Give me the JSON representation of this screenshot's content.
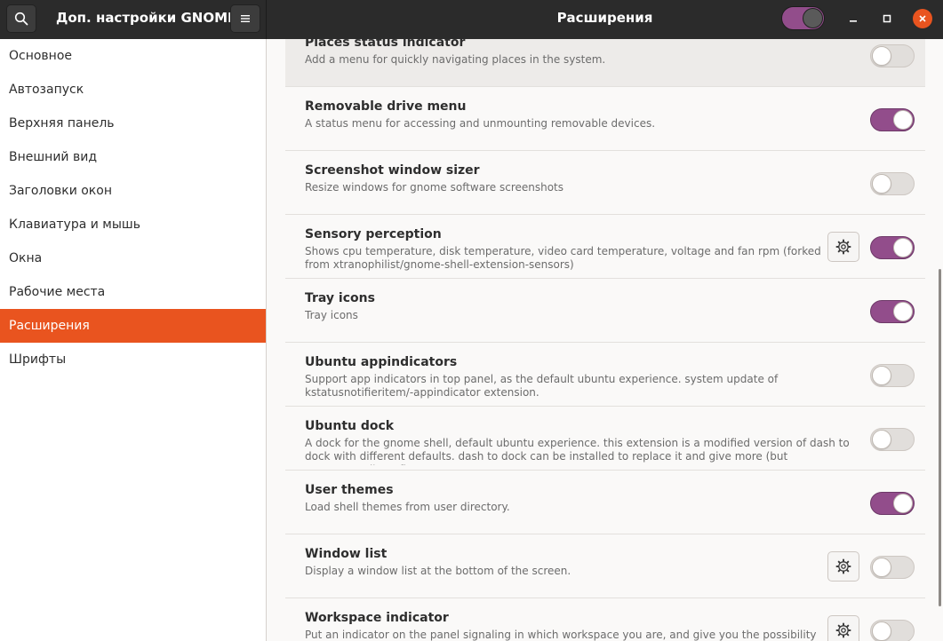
{
  "window": {
    "app_title": "Доп. настройки GNOME",
    "page_title": "Расширения",
    "global_toggle_on": true
  },
  "icons": {
    "search": "search-icon",
    "menu": "hamburger-menu-icon",
    "minimize": "minimize-icon",
    "maximize": "maximize-icon",
    "close": "close-icon",
    "settings": "gear-icon"
  },
  "colors": {
    "accent": "#e9541f",
    "switch_on": "#924d8b",
    "header": "#2b2b2b"
  },
  "sidebar": {
    "items": [
      {
        "label": "Основное"
      },
      {
        "label": "Автозапуск"
      },
      {
        "label": "Верхняя панель"
      },
      {
        "label": "Внешний вид"
      },
      {
        "label": "Заголовки окон"
      },
      {
        "label": "Клавиатура и мышь"
      },
      {
        "label": "Окна"
      },
      {
        "label": "Рабочие места"
      },
      {
        "label": "Расширения"
      },
      {
        "label": "Шрифты"
      }
    ],
    "active_label": "Расширения"
  },
  "extensions": [
    {
      "name": "Places status indicator",
      "description": "Add a menu for quickly navigating places in the system.",
      "enabled": false,
      "has_settings": false
    },
    {
      "name": "Removable drive menu",
      "description": "A status menu for accessing and unmounting removable devices.",
      "enabled": true,
      "has_settings": false
    },
    {
      "name": "Screenshot window sizer",
      "description": "Resize windows for gnome software screenshots",
      "enabled": false,
      "has_settings": false
    },
    {
      "name": "Sensory perception",
      "description": "Shows cpu temperature, disk temperature, video card temperature, voltage and fan rpm (forked from xtranophilist/gnome-shell-extension-sensors)",
      "enabled": true,
      "has_settings": true
    },
    {
      "name": "Tray icons",
      "description": "Tray icons",
      "enabled": true,
      "has_settings": false
    },
    {
      "name": "Ubuntu appindicators",
      "description": "Support app indicators in top panel, as the default ubuntu experience. system update of kstatusnotifieritem/-appindicator extension.",
      "enabled": false,
      "has_settings": false
    },
    {
      "name": "Ubuntu dock",
      "description": "A dock for the gnome shell, default ubuntu experience. this extension is a modified version of dash to dock with different defaults. dash to dock can be installed to replace it and give more (but unsupported) configura…",
      "enabled": false,
      "has_settings": false
    },
    {
      "name": "User themes",
      "description": "Load shell themes from user directory.",
      "enabled": true,
      "has_settings": false
    },
    {
      "name": "Window list",
      "description": "Display a window list at the bottom of the screen.",
      "enabled": false,
      "has_settings": true
    },
    {
      "name": "Workspace indicator",
      "description": "Put an indicator on the panel signaling in which workspace you are, and give you the possibility of switching to another one.",
      "enabled": false,
      "has_settings": true
    }
  ]
}
